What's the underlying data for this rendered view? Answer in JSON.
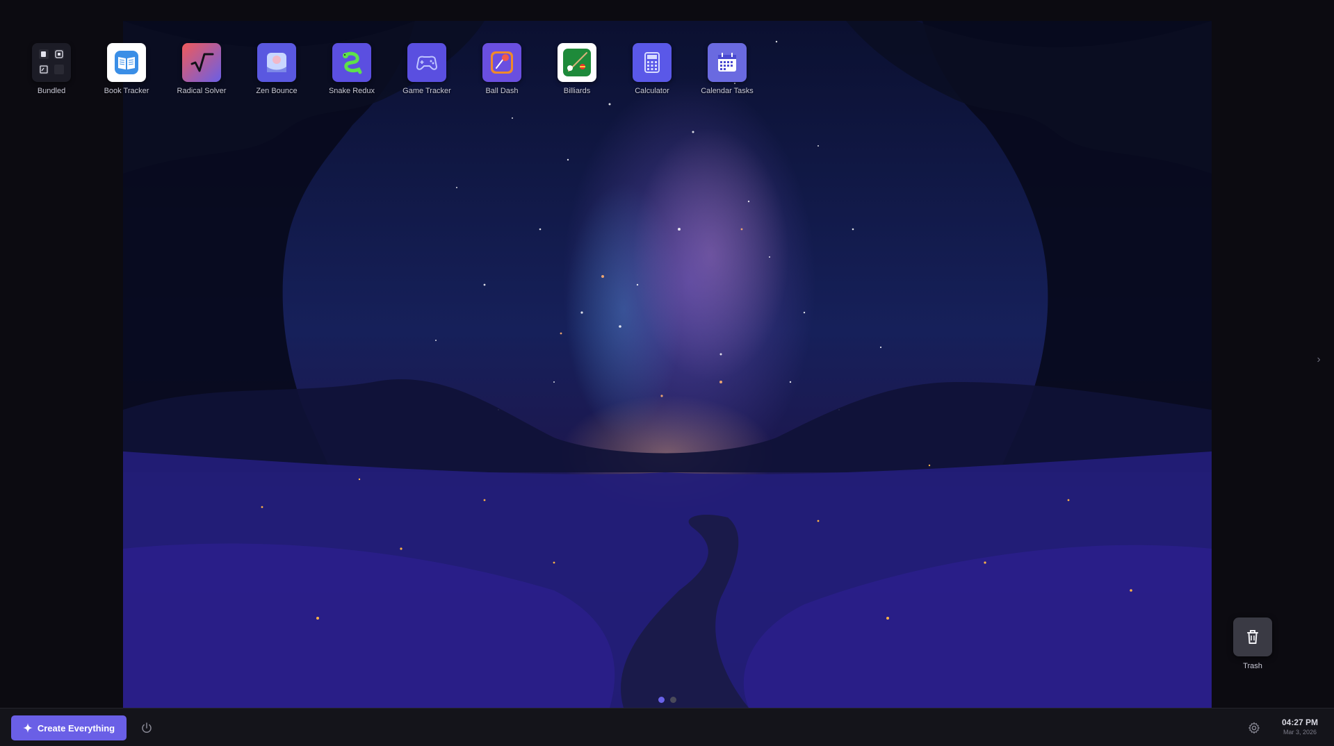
{
  "desktop": {
    "apps": [
      {
        "label": "Bundled",
        "icon": "bundled-folder-icon"
      },
      {
        "label": "Book Tracker",
        "icon": "open-book-icon"
      },
      {
        "label": "Radical Solver",
        "icon": "square-root-icon"
      },
      {
        "label": "Zen Bounce",
        "icon": "bouncing-ball-icon"
      },
      {
        "label": "Snake Redux",
        "icon": "snake-icon"
      },
      {
        "label": "Game Tracker",
        "icon": "gamepad-icon"
      },
      {
        "label": "Ball Dash",
        "icon": "ball-dash-icon"
      },
      {
        "label": "Billiards",
        "icon": "billiards-icon"
      },
      {
        "label": "Calculator",
        "icon": "calculator-icon"
      },
      {
        "label": "Calendar Tasks",
        "icon": "calendar-icon"
      }
    ],
    "trash": {
      "label": "Trash",
      "icon": "trash-icon"
    },
    "pager": {
      "pages": 2,
      "current": 1
    }
  },
  "taskbar": {
    "create_label": "Create Everything",
    "create_icon": "sparkle-icon",
    "power_icon": "power-icon",
    "settings_icon": "gear-icon",
    "time": "04:27 PM",
    "date": "Mar 3, 2026"
  },
  "colors": {
    "accent": "#6a5fe6",
    "taskbar_bg": "#14141a",
    "desktop_bg": "#0c0b11"
  }
}
